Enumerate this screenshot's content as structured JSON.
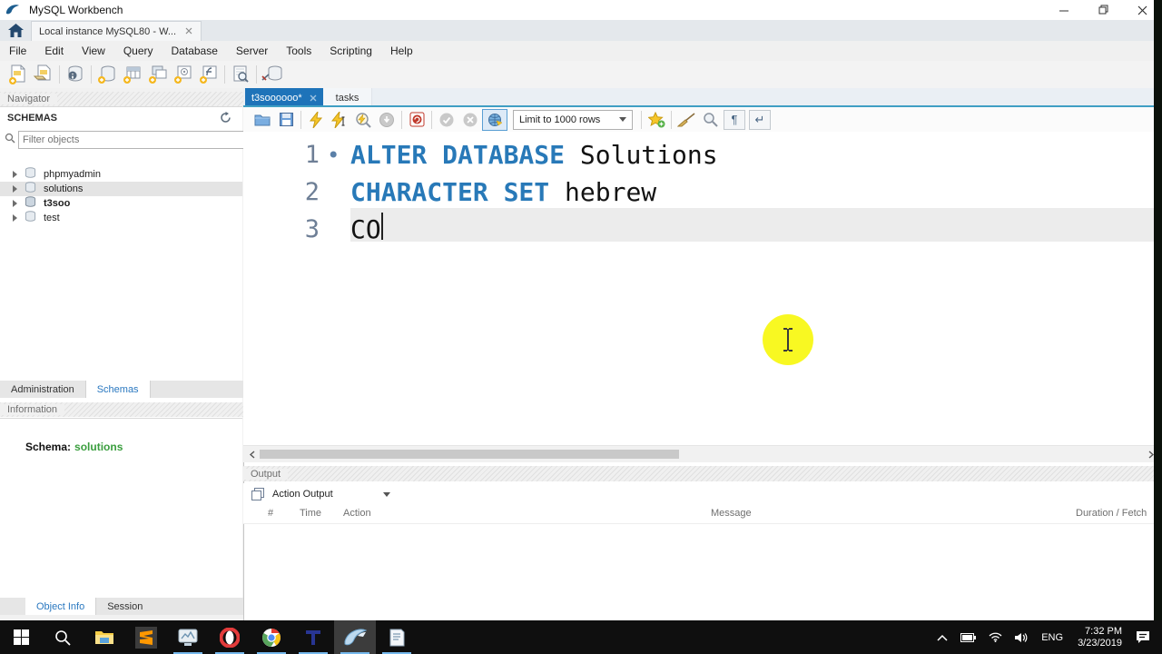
{
  "window": {
    "title": "MySQL Workbench"
  },
  "connection_tab": {
    "label": "Local instance MySQL80 - W..."
  },
  "menu": {
    "items": [
      "File",
      "Edit",
      "View",
      "Query",
      "Database",
      "Server",
      "Tools",
      "Scripting",
      "Help"
    ]
  },
  "main_toolbar": {
    "icons": [
      "new-sql-tab",
      "open-sql-file",
      "inspector",
      "create-schema",
      "create-table",
      "create-view",
      "create-procedure",
      "create-function",
      "search-objects",
      "reconnect",
      "user-account",
      "toggle-left-panel",
      "toggle-bottom-panel",
      "toggle-right-panel"
    ]
  },
  "query_tabs": {
    "active": "t3soooooo*",
    "inactive": "tasks"
  },
  "editor_toolbar": {
    "limit_dropdown": "Limit to 1000 rows",
    "icons": [
      "open-file",
      "save",
      "execute",
      "execute-current",
      "explain",
      "stop",
      "toggle-autocommit",
      "commit",
      "rollback",
      "toggle-limit",
      "new-snippet",
      "beautify",
      "find",
      "show-invisibles",
      "wrap-text"
    ]
  },
  "editor": {
    "lines": [
      {
        "num": "1",
        "bullet": "•",
        "kw": "ALTER DATABASE ",
        "rest": "Solutions"
      },
      {
        "num": "2",
        "bullet": "",
        "kw": "CHARACTER SET ",
        "rest": "hebrew"
      },
      {
        "num": "3",
        "bullet": "",
        "kw": "",
        "rest": "CO"
      }
    ]
  },
  "navigator": {
    "header": "Navigator",
    "section_title": "SCHEMAS",
    "filter_placeholder": "Filter objects",
    "schemas": [
      {
        "name": "phpmyadmin"
      },
      {
        "name": "solutions"
      },
      {
        "name": "t3soo"
      },
      {
        "name": "test"
      }
    ],
    "tabs": {
      "administration": "Administration",
      "schemas": "Schemas"
    },
    "information_header": "Information",
    "schema_label": "Schema:",
    "schema_value": "solutions",
    "bottom_tabs": {
      "object_info": "Object Info",
      "session": "Session"
    }
  },
  "output": {
    "header": "Output",
    "view_selector": "Action Output",
    "columns": [
      "#",
      "Time",
      "Action",
      "Message",
      "Duration / Fetch"
    ]
  },
  "taskbar": {
    "icons": [
      "start",
      "search",
      "file-explorer",
      "sublime-text",
      "media-app",
      "opera",
      "chrome",
      "t-app",
      "mysql-workbench",
      "notepad"
    ],
    "tray": {
      "language": "ENG",
      "time": "7:32 PM",
      "date": "3/23/2019"
    }
  },
  "icons": {
    "bullet": "•",
    "pilcrow": "¶",
    "wrap_return": "↵"
  },
  "colors": {
    "accent_blue": "#1e73b9",
    "keyword_blue": "#2879b8",
    "schema_green": "#3a9e3e",
    "highlight_yellow": "#f8f822",
    "tab_underline": "#3f9fc4"
  }
}
